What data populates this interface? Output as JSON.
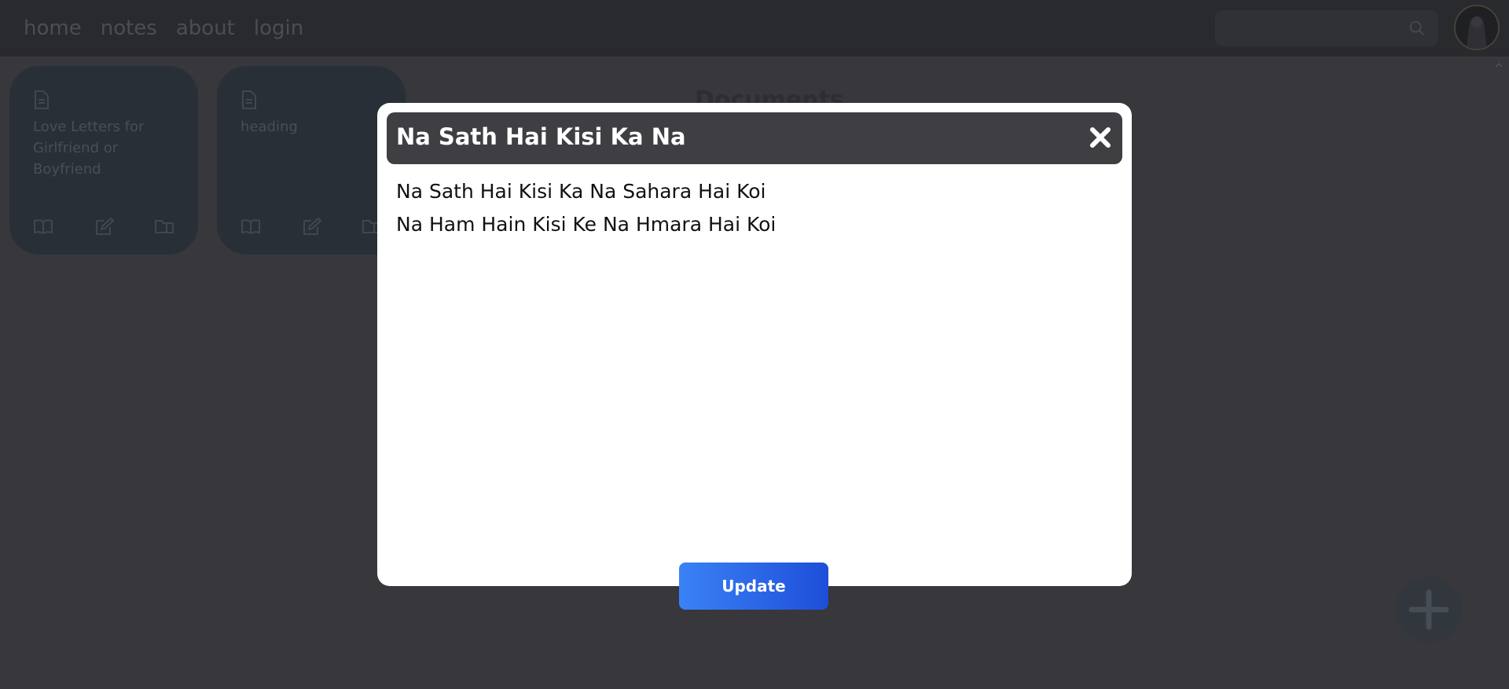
{
  "navbar": {
    "links": [
      {
        "label": "home"
      },
      {
        "label": "notes"
      },
      {
        "label": "about"
      },
      {
        "label": "login"
      }
    ],
    "search": {
      "placeholder": "",
      "value": ""
    }
  },
  "main": {
    "heading": "Documents",
    "cards": [
      {
        "title": "Love Letters for Girlfriend or Boyfriend"
      },
      {
        "title": "heading"
      }
    ]
  },
  "modal": {
    "title": "Na Sath Hai Kisi Ka Na",
    "body_lines": [
      "Na Sath Hai Kisi Ka Na Sahara Hai Koi",
      "Na Ham Hain Kisi Ke Na Hmara Hai Koi"
    ],
    "update_label": "Update"
  },
  "colors": {
    "accent_gradient_start": "#3b82f6",
    "accent_gradient_end": "#1d4ed8",
    "navbar_bg": "#3f4044",
    "card_bg": "#3d4b55"
  },
  "icons": {
    "search": "search-icon",
    "close": "close-icon",
    "card_doc": "document-icon",
    "card_read": "book-open-icon",
    "card_edit": "edit-icon",
    "card_folder": "folder-icon",
    "fab": "plus-icon"
  }
}
